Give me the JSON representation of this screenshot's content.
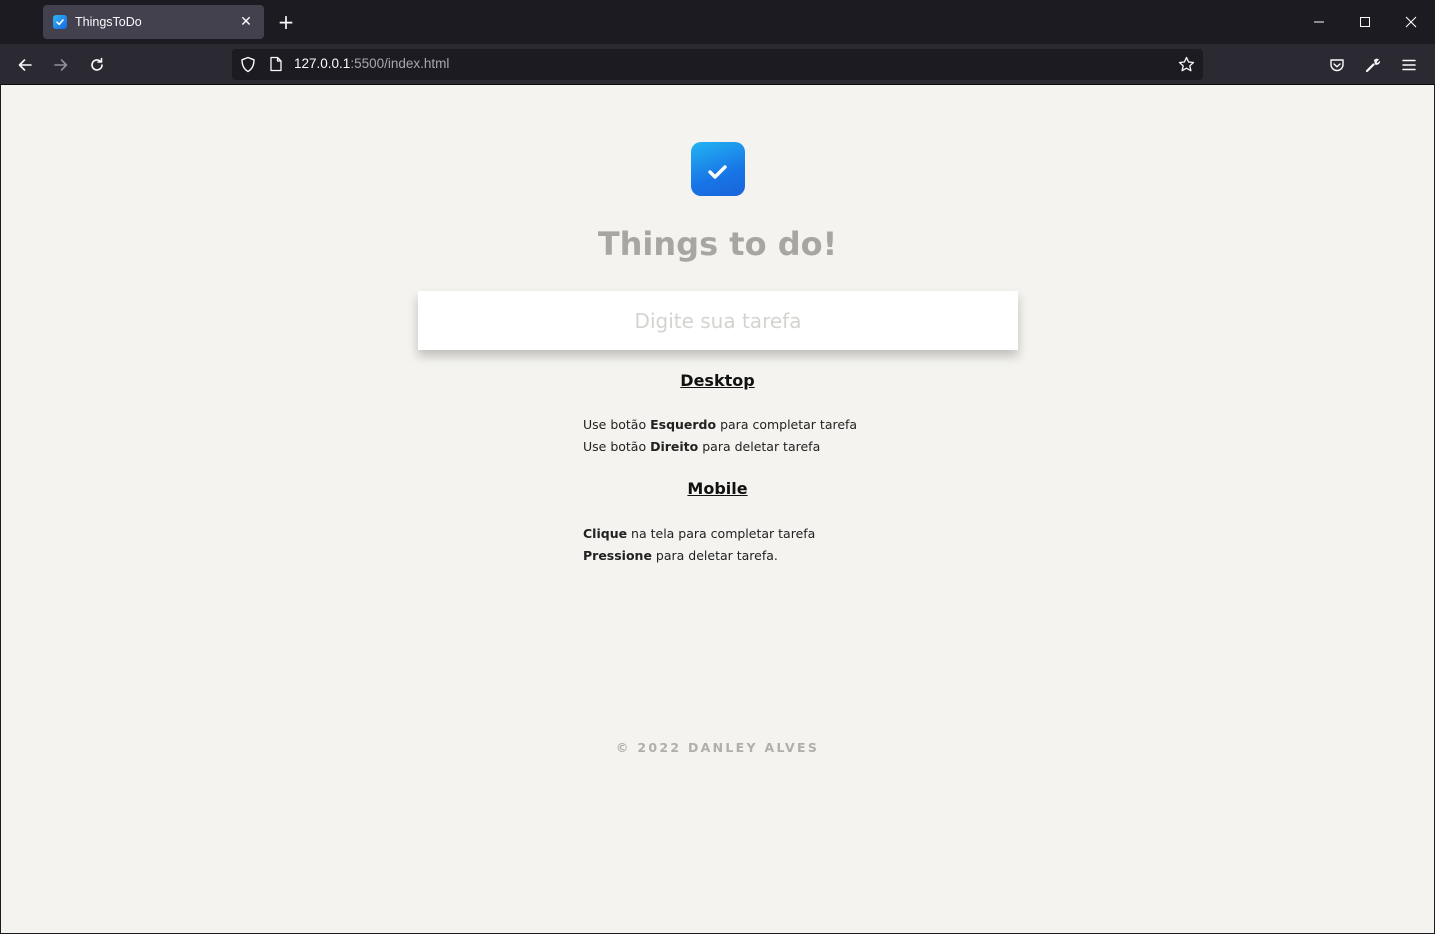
{
  "browser": {
    "tab": {
      "title": "ThingsToDo",
      "close_glyph": "✕"
    },
    "new_tab_glyph": "+",
    "url": {
      "host": "127.0.0.1",
      "path": ":5500/index.html"
    },
    "icons": {
      "back": "arrow-left-icon",
      "forward": "arrow-right-icon",
      "reload": "reload-icon",
      "shield": "shield-icon",
      "page": "page-icon",
      "bookmark": "star-icon",
      "pocket": "pocket-icon",
      "tools": "wrench-icon",
      "menu": "hamburger-menu-icon"
    }
  },
  "app": {
    "logo_icon": "checkbox-check-icon",
    "title": "Things to do!",
    "input": {
      "placeholder": "Digite sua tarefa",
      "value": ""
    },
    "desktop": {
      "heading": "Desktop",
      "line1": {
        "before": "Use botão ",
        "bold": "Esquerdo",
        "after": " para completar tarefa"
      },
      "line2": {
        "before": "Use botão ",
        "bold": "Direito",
        "after": " para deletar tarefa"
      }
    },
    "mobile": {
      "heading": "Mobile",
      "line1": {
        "bold": "Clique",
        "after": " na tela para completar tarefa"
      },
      "line2": {
        "bold": "Pressione",
        "after": " para deletar tarefa."
      }
    },
    "footer": "© 2022 DANLEY ALVES"
  },
  "colors": {
    "page_bg": "#f4f3ef",
    "title": "#a8a6a1",
    "footer": "#b1afaa",
    "logo_gradient_start": "#23b4f3",
    "logo_gradient_end": "#1a63d8"
  }
}
